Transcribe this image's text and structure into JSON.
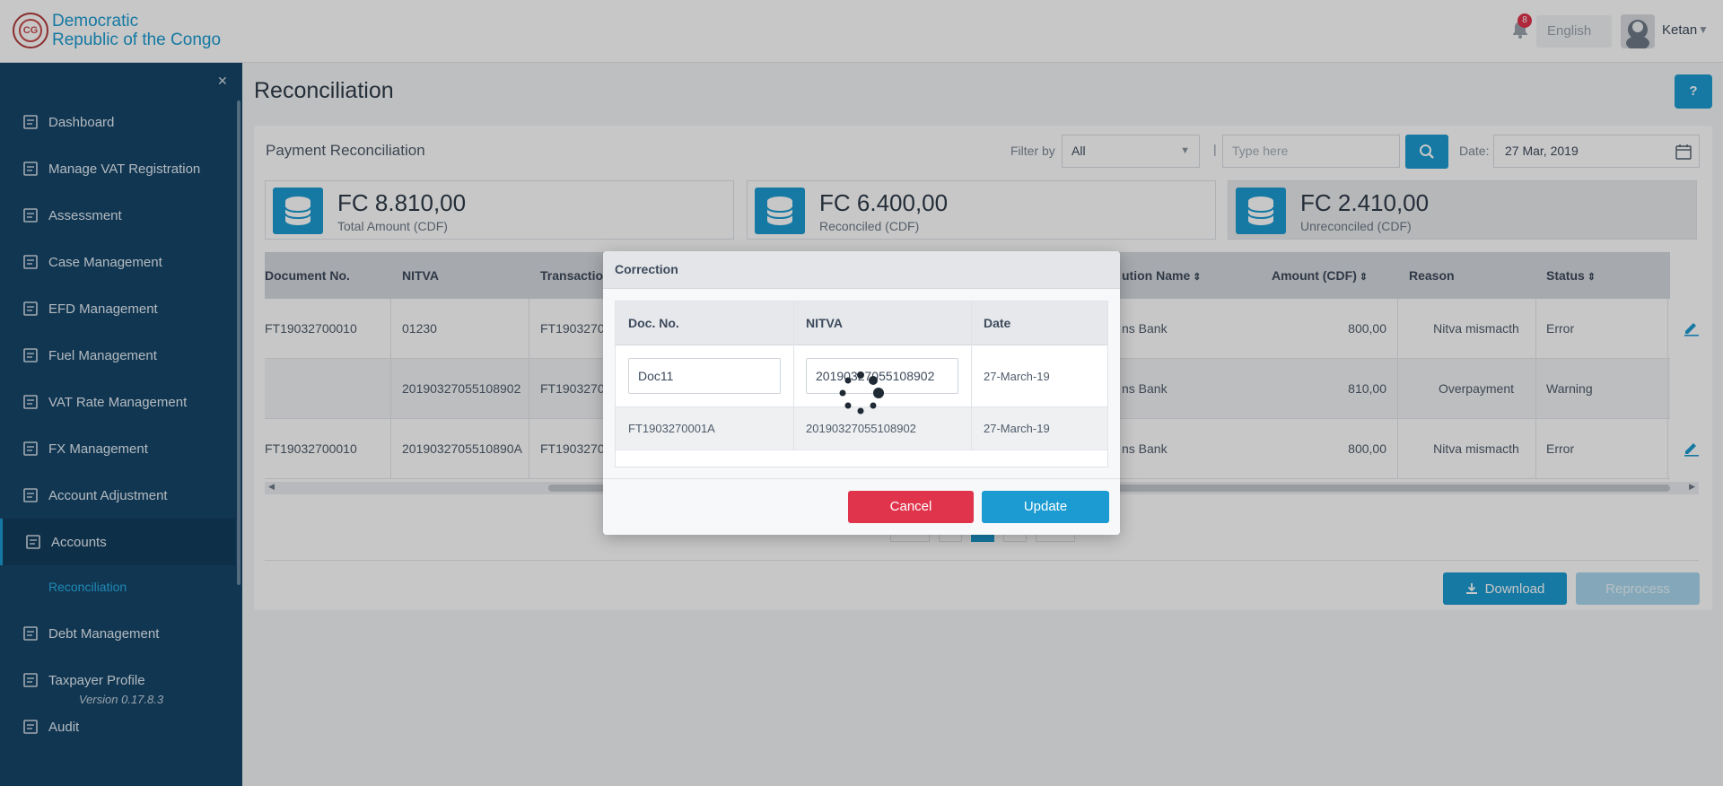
{
  "header": {
    "brand_line1": "Democratic",
    "brand_line2": "Republic of the Congo",
    "seal_text": "CG",
    "notification_count": "8",
    "language": "English",
    "user_name": "Ketan"
  },
  "sidebar": {
    "items": [
      {
        "label": "Dashboard",
        "icon": "dashboard-icon"
      },
      {
        "label": "Manage VAT Registration",
        "icon": "registration-icon"
      },
      {
        "label": "Assessment",
        "icon": "assessment-icon"
      },
      {
        "label": "Case Management",
        "icon": "folder-icon"
      },
      {
        "label": "EFD Management",
        "icon": "device-icon"
      },
      {
        "label": "Fuel Management",
        "icon": "fuel-icon"
      },
      {
        "label": "VAT Rate Management",
        "icon": "rate-icon"
      },
      {
        "label": "FX Management",
        "icon": "exchange-icon"
      },
      {
        "label": "Account Adjustment",
        "icon": "adjustment-icon"
      },
      {
        "label": "Accounts",
        "icon": "accounts-icon"
      },
      {
        "label": "Debt Management",
        "icon": "debt-icon"
      },
      {
        "label": "Taxpayer Profile",
        "icon": "profile-icon"
      },
      {
        "label": "Audit",
        "icon": "audit-icon"
      }
    ],
    "sub_item": "Reconciliation",
    "version": "Version 0.17.8.3"
  },
  "page": {
    "title": "Reconciliation",
    "help_label": "?",
    "card_title": "Payment Reconciliation",
    "filter_label": "Filter by",
    "filter_value": "All",
    "search_placeholder": "Type here",
    "date_label": "Date:",
    "date_value": "27 Mar, 2019",
    "download_label": "Download",
    "reprocess_label": "Reprocess"
  },
  "stats": [
    {
      "amount": "FC 8.810,00",
      "label": "Total Amount (CDF)"
    },
    {
      "amount": "FC 6.400,00",
      "label": "Reconciled (CDF)"
    },
    {
      "amount": "FC 2.410,00",
      "label": "Unreconciled (CDF)"
    }
  ],
  "table": {
    "headers": [
      "Document No.",
      "NITVA",
      "Transaction",
      "ution Name",
      "Amount (CDF)",
      "Reason",
      "Status"
    ],
    "rows": [
      {
        "doc": "FT19032700010",
        "nitva": "01230",
        "txn": "FT1903270",
        "inst": "ns Bank",
        "amount": "800,00",
        "reason": "Nitva mismacth",
        "status": "Error"
      },
      {
        "doc": "",
        "nitva": "20190327055108902",
        "txn": "FT1903270",
        "inst": "ns Bank",
        "amount": "810,00",
        "reason": "Overpayment",
        "status": "Warning"
      },
      {
        "doc": "FT19032700010",
        "nitva": "20190327055108​90A",
        "txn": "FT1903270",
        "inst": "ns Bank",
        "amount": "800,00",
        "reason": "Nitva mismacth",
        "status": "Error"
      }
    ]
  },
  "modal": {
    "title": "Correction",
    "headers": [
      "Doc. No.",
      "NITVA",
      "Date"
    ],
    "row1": {
      "doc": "Doc11",
      "nitva": "20190327055108902",
      "date": "27-March-19"
    },
    "row2": {
      "doc": "FT1903270001A",
      "nitva": "20190327055108902",
      "date": "27-March-19"
    },
    "cancel_label": "Cancel",
    "update_label": "Update"
  },
  "colors": {
    "accent": "#1b9bd1",
    "sidebar": "#15466a",
    "danger": "#e0344c"
  }
}
